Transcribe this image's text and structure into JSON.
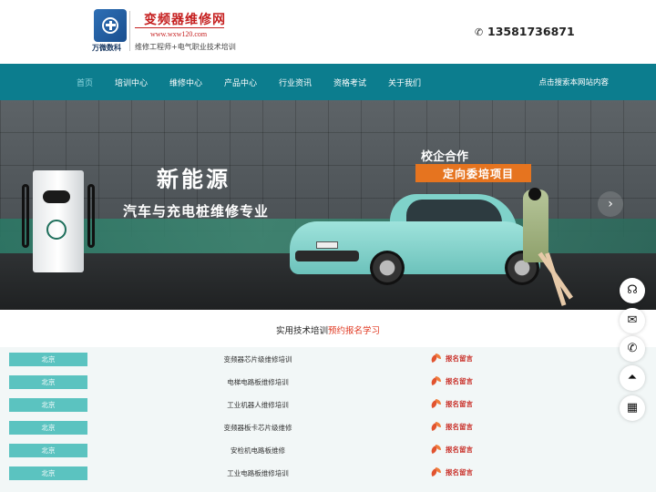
{
  "header": {
    "company_name": "万微数科",
    "site_name": "变频器维修网",
    "site_url": "www.wxw120.com",
    "slogan": "维修工程师+电气职业技术培训",
    "phone": "13581736871"
  },
  "nav": {
    "items": [
      {
        "label": "首页",
        "active": true
      },
      {
        "label": "培训中心",
        "active": false
      },
      {
        "label": "维修中心",
        "active": false
      },
      {
        "label": "产品中心",
        "active": false
      },
      {
        "label": "行业资讯",
        "active": false
      },
      {
        "label": "资格考试",
        "active": false
      },
      {
        "label": "关于我们",
        "active": false
      }
    ],
    "search_label": "点击搜索本网站内容"
  },
  "banner": {
    "title": "新能源",
    "subtitle": "汽车与充电桩维修专业",
    "coop_title": "校企合作",
    "coop_label": "定向委培项目",
    "next_arrow": "›"
  },
  "courses_heading": {
    "prefix": "实用技术培训",
    "highlight": "预约报名学习"
  },
  "courses": [
    {
      "city": "北京",
      "name": "变频器芯片级维修培训",
      "action": "报名留言"
    },
    {
      "city": "北京",
      "name": "电梯电路板维修培训",
      "action": "报名留言"
    },
    {
      "city": "北京",
      "name": "工业机器人维修培训",
      "action": "报名留言"
    },
    {
      "city": "北京",
      "name": "变频器板卡芯片级维修",
      "action": "报名留言"
    },
    {
      "city": "北京",
      "name": "安检机电路板维修",
      "action": "报名留言"
    },
    {
      "city": "北京",
      "name": "工业电路板维修培训",
      "action": "报名留言"
    }
  ],
  "side_tools": [
    {
      "icon": "headset-icon"
    },
    {
      "icon": "wechat-icon"
    },
    {
      "icon": "phone-icon"
    },
    {
      "icon": "back-to-top-icon"
    },
    {
      "icon": "apps-icon"
    }
  ],
  "colors": {
    "nav_bg": "#0c7d8e",
    "accent_orange": "#e6741f",
    "city_tag": "#5bc3c0",
    "signup_red": "#c9312a"
  }
}
